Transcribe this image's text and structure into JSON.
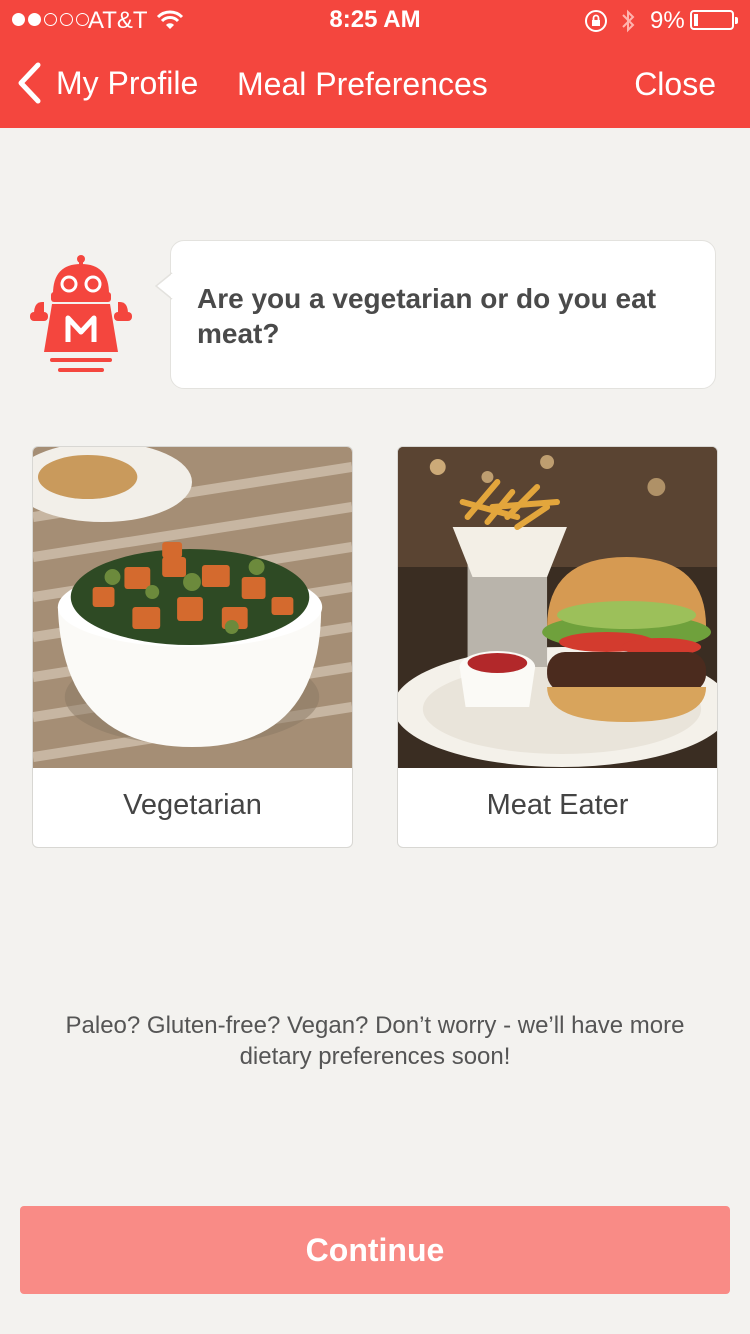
{
  "status_bar": {
    "carrier": "AT&T",
    "time": "8:25 AM",
    "battery_percent": "9%",
    "signal_bars_filled": 2,
    "signal_bars_total": 5
  },
  "nav": {
    "back_label": "My Profile",
    "title": "Meal Preferences",
    "close_label": "Close"
  },
  "prompt": {
    "question": "Are you a vegetarian or do you eat meat?"
  },
  "options": [
    {
      "label": "Vegetarian",
      "image": "kale-sweet-potato-salad-bowl"
    },
    {
      "label": "Meat Eater",
      "image": "burger-and-fries-plate"
    }
  ],
  "footnote": {
    "line1": "Paleo? Gluten-free? Vegan? Don’t worry - we’ll have more",
    "line2": "dietary preferences soon!"
  },
  "continue_label": "Continue",
  "colors": {
    "brand": "#f4463e",
    "continue_disabled": "#f98b86",
    "background": "#f3f2ef",
    "text_dark": "#4a4a4a"
  }
}
